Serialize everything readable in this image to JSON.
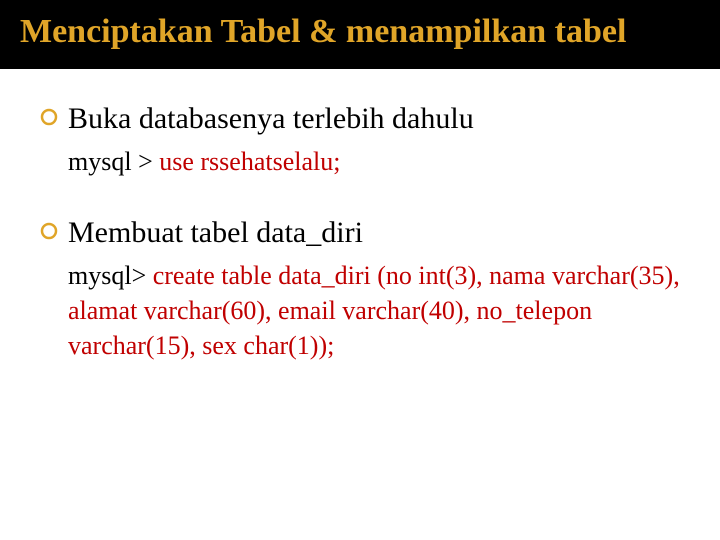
{
  "title": "Menciptakan Tabel & menampilkan tabel",
  "sections": [
    {
      "heading": "Buka databasenya terlebih dahulu",
      "prompt": "mysql > ",
      "command": "use rssehatselalu;"
    },
    {
      "heading": "Membuat tabel data_diri",
      "prompt": "mysql> ",
      "command": "create table data_diri (no int(3), nama varchar(35), alamat varchar(60), email varchar(40), no_telepon varchar(15), sex char(1));"
    }
  ]
}
